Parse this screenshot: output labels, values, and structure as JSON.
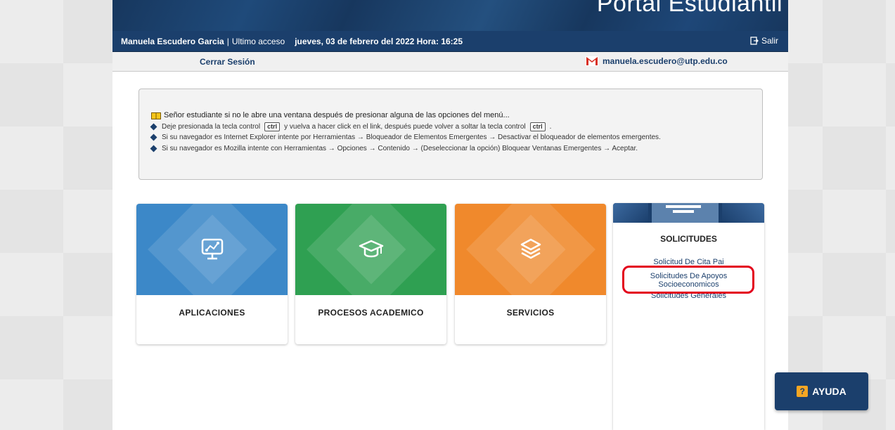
{
  "header": {
    "banner_title": "Portal Estudiantil",
    "user_name": "Manuela Escudero Garcia",
    "separator": "|",
    "last_access_label": "Ultimo acceso",
    "last_access_value": "jueves, 03 de febrero del 2022 Hora: 16:25",
    "salir_label": "Salir",
    "cerrar_sesion_label": "Cerrar Sesión",
    "email": "manuela.escudero@utp.edu.co"
  },
  "notice": {
    "title": "Señor estudiante si no le abre una ventana después de presionar alguna de las opciones del menú...",
    "row1_a": "Deje presionada la tecla control",
    "row1_key": "ctrl",
    "row1_b": "y vuelva a hacer click en el link, después puede volver a soltar la tecla control",
    "row1_key2": "ctrl",
    "row1_c": ".",
    "row2": "Si su navegador es Internet Explorer intente por Herramientas → Bloqueador de Elementos Emergentes → Desactivar el bloqueador de elementos emergentes.",
    "row3": "Si su navegador es Mozilla intente con Herramientas → Opciones → Contenido → (Deseleccionar la opción) Bloquear Ventanas Emergentes → Aceptar."
  },
  "cards": [
    {
      "label": "APLICACIONES",
      "color": "#3c88c8"
    },
    {
      "label": "PROCESOS ACADEMICO",
      "color": "#2fa052"
    },
    {
      "label": "SERVICIOS",
      "color": "#f0892c"
    }
  ],
  "solicitudes": {
    "title": "SOLICITUDES",
    "links": [
      "Solicitud De Cita Pai",
      "Solicitudes De Apoyos",
      "Socioeconomicos",
      "Solicitudes Generales"
    ]
  },
  "help_button": {
    "label": "AYUDA",
    "icon_glyph": "?"
  },
  "colors": {
    "brand_blue": "#1b3f6c",
    "highlight_red": "#e3001b"
  }
}
